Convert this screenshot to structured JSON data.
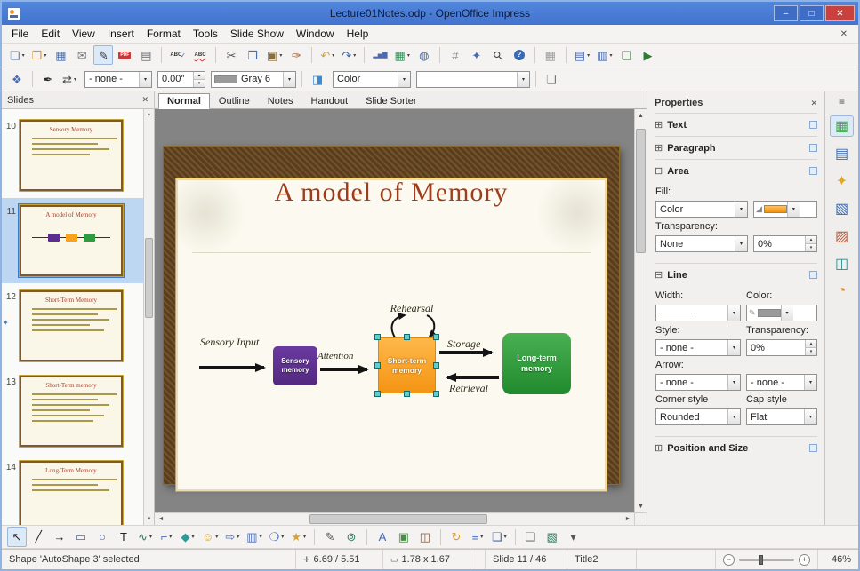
{
  "ui": {
    "dd": "▾",
    "up": "▴",
    "left": "◄",
    "right": "►",
    "scroll_up": "▲",
    "scroll_down": "▼",
    "indicator": "✦"
  },
  "titlebar": {
    "title": "Lecture01Notes.odp - OpenOffice Impress",
    "minimize": "–",
    "maximize": "□",
    "close": "✕"
  },
  "menubar": {
    "items": [
      "File",
      "Edit",
      "View",
      "Insert",
      "Format",
      "Tools",
      "Slide Show",
      "Window",
      "Help"
    ],
    "close": "✕"
  },
  "main_toolbar": [
    {
      "name": "new-document",
      "glyph": "❏",
      "color": "#5a86c8",
      "dd": true
    },
    {
      "name": "open",
      "glyph": "❒",
      "color": "#d89a3a",
      "dd": true
    },
    {
      "name": "save",
      "glyph": "▦",
      "color": "#4a6da7"
    },
    {
      "name": "document-as-email",
      "glyph": "✉",
      "color": "#7a7a7a"
    },
    {
      "name": "edit-file",
      "glyph": "✎",
      "color": "#333333",
      "active": true
    },
    {
      "name": "export-pdf",
      "glyph": "PDF",
      "badge": "#c83a3a"
    },
    {
      "name": "print",
      "glyph": "▤",
      "color": "#666666"
    },
    {
      "sep": true
    },
    {
      "name": "spellcheck",
      "abc": "check"
    },
    {
      "name": "autospellcheck",
      "abc": "wavy"
    },
    {
      "sep": true
    },
    {
      "name": "cut",
      "glyph": "✂",
      "color": "#555555"
    },
    {
      "name": "copy",
      "glyph": "❐",
      "color": "#4a6da7"
    },
    {
      "name": "paste",
      "glyph": "▣",
      "color": "#8a6d3b",
      "dd": true
    },
    {
      "name": "format-paintbrush",
      "glyph": "✑",
      "color": "#a05a2a"
    },
    {
      "sep": true
    },
    {
      "name": "undo",
      "glyph": "↶",
      "color": "#d8a23a",
      "dd": true
    },
    {
      "name": "redo",
      "glyph": "↷",
      "color": "#3a6ab0",
      "dd": true
    },
    {
      "sep": true
    },
    {
      "name": "chart",
      "glyph": "▂▅▇",
      "color": "#4a6ab0",
      "sm": true
    },
    {
      "name": "table",
      "glyph": "▦",
      "color": "#3a8a5a",
      "dd": true
    },
    {
      "name": "hyperlink",
      "glyph": "◍",
      "color": "#3a6ab0"
    },
    {
      "sep": true
    },
    {
      "name": "show-grid",
      "glyph": "#",
      "color": "#888888"
    },
    {
      "name": "navigator",
      "glyph": "✦",
      "color": "#4a6ab0"
    },
    {
      "name": "zoom",
      "glyph": "⚲",
      "color": "#444444"
    },
    {
      "name": "help",
      "glyph": "?",
      "badge": "#3a6ab0",
      "round": true
    },
    {
      "sep": true
    },
    {
      "name": "display-grid",
      "glyph": "▦",
      "color": "#999999"
    },
    {
      "sep": true
    },
    {
      "name": "slide-design",
      "glyph": "▤",
      "color": "#4a6ab0",
      "dd": true
    },
    {
      "name": "slide-layout",
      "glyph": "▥",
      "color": "#4a6ab0",
      "dd": true
    },
    {
      "name": "duplicate-slide",
      "glyph": "❏",
      "color": "#4a8a4a"
    },
    {
      "name": "slide-show",
      "glyph": "▶",
      "color": "#2e7d32"
    }
  ],
  "linefill_toolbar": {
    "line_style": "- none -",
    "line_width": "0.00\"",
    "line_color": "Gray 6",
    "fill_type": "Color",
    "fill_color": ""
  },
  "slides_panel": {
    "title": "Slides",
    "close": "✕",
    "slides": [
      {
        "number": "10",
        "title": "Sensory Memory",
        "kind": "bullets",
        "bullets": 4
      },
      {
        "number": "11",
        "title": "A model of Memory",
        "kind": "diagram",
        "selected": true
      },
      {
        "number": "12",
        "title": "Short-Term Memory",
        "kind": "bullets",
        "bullets": 5,
        "indicator": true
      },
      {
        "number": "13",
        "title": "Short-Term memory",
        "kind": "bullets",
        "bullets": 6
      },
      {
        "number": "14",
        "title": "Long-Term Memory",
        "kind": "bullets",
        "bullets": 3
      }
    ],
    "box_colors": [
      "#5c2d91",
      "#f9a21a",
      "#2e9b3e"
    ]
  },
  "view_tabs": [
    {
      "label": "Normal",
      "active": true
    },
    {
      "label": "Outline"
    },
    {
      "label": "Notes"
    },
    {
      "label": "Handout"
    },
    {
      "label": "Slide Sorter"
    }
  ],
  "slide": {
    "title": "A model of Memory",
    "labels": {
      "input": "Sensory Input",
      "attention": "Attention",
      "rehearsal": "Rehearsal",
      "storage": "Storage",
      "retrieval": "Retrieval"
    },
    "boxes": {
      "sensory_line1": "Sensory",
      "sensory_line2": "memory",
      "short_line1": "Short-term",
      "short_line2": "memory",
      "long_line1": "Long-term",
      "long_line2": "memory"
    }
  },
  "properties": {
    "title": "Properties",
    "close": "✕",
    "exp_plus": "⊞",
    "exp_minus": "⊟",
    "icons": {
      "fill": "◢",
      "pencil": "✎"
    },
    "sections": {
      "text": "Text",
      "paragraph": "Paragraph",
      "area": "Area",
      "line": "Line",
      "possize": "Position and Size"
    },
    "area": {
      "fill_label": "Fill:",
      "fill_type": "Color",
      "transparency_label": "Transparency:",
      "transparency_type": "None",
      "transparency_value": "0%"
    },
    "line": {
      "width_label": "Width:",
      "color_label": "Color:",
      "style_label": "Style:",
      "style_value": "- none -",
      "transparency_label": "Transparency:",
      "transparency_value": "0%",
      "arrow_label": "Arrow:",
      "arrow_start": "- none -",
      "arrow_end": "- none -",
      "corner_label": "Corner style",
      "corner_value": "Rounded",
      "cap_label": "Cap style",
      "cap_value": "Flat"
    }
  },
  "sidebar_tabs": [
    {
      "name": "sidebar-properties-tab",
      "glyph": "▦",
      "color": "#3fae49",
      "active": true
    },
    {
      "name": "sidebar-master-pages-tab",
      "glyph": "▤",
      "color": "#3a6ab0"
    },
    {
      "name": "sidebar-custom-animation-tab",
      "glyph": "✦",
      "color": "#e0a82a"
    },
    {
      "name": "sidebar-slide-transition-tab",
      "glyph": "▧",
      "color": "#3a6ab0"
    },
    {
      "name": "sidebar-styles-tab",
      "glyph": "▨",
      "color": "#b05a3a"
    },
    {
      "name": "sidebar-gallery-tab",
      "glyph": "◫",
      "color": "#2e8b8b"
    },
    {
      "name": "sidebar-navigator-tab",
      "glyph": "◔",
      "color": "#e08a2a"
    }
  ],
  "sidebar_menu": "≡",
  "draw_toolbar": [
    {
      "name": "select",
      "glyph": "↖",
      "color": "#222222",
      "active": true
    },
    {
      "name": "line",
      "glyph": "╱",
      "color": "#222222"
    },
    {
      "name": "line-arrow-end",
      "glyph": "→",
      "color": "#222222"
    },
    {
      "name": "rectangle",
      "glyph": "▭",
      "color": "#4a6ab0"
    },
    {
      "name": "ellipse",
      "glyph": "○",
      "color": "#4a6ab0"
    },
    {
      "name": "text",
      "glyph": "T",
      "color": "#222222"
    },
    {
      "name": "curve",
      "glyph": "∿",
      "color": "#2a7a5a",
      "dd": true
    },
    {
      "name": "connector",
      "glyph": "⌐",
      "color": "#4a6ab0",
      "dd": true
    },
    {
      "name": "basic-shapes",
      "glyph": "◆",
      "color": "#2a9a9a",
      "dd": true
    },
    {
      "name": "symbol-shapes",
      "glyph": "☺",
      "color": "#d8a23a",
      "dd": true
    },
    {
      "name": "block-arrows",
      "glyph": "⇨",
      "color": "#4a6ab0",
      "dd": true
    },
    {
      "name": "flowchart",
      "glyph": "▥",
      "color": "#4a6ab0",
      "dd": true
    },
    {
      "name": "callouts",
      "glyph": "❍",
      "color": "#4a6ab0",
      "dd": true
    },
    {
      "name": "stars",
      "glyph": "★",
      "color": "#d8a23a",
      "dd": true
    },
    {
      "sep": true
    },
    {
      "name": "edit-points",
      "glyph": "✎",
      "color": "#555555"
    },
    {
      "name": "glue-points",
      "glyph": "⊚",
      "color": "#2a7a5a"
    },
    {
      "sep": true
    },
    {
      "name": "fontwork-gallery",
      "glyph": "A",
      "color": "#3a6ab0"
    },
    {
      "name": "insert-picture",
      "glyph": "▣",
      "color": "#4a8a4a"
    },
    {
      "name": "gallery",
      "glyph": "◫",
      "color": "#8a5a3a"
    },
    {
      "sep": true
    },
    {
      "name": "rotate",
      "glyph": "↻",
      "color": "#d89a2a"
    },
    {
      "name": "alignment",
      "glyph": "≡",
      "color": "#4a6ab0",
      "dd": true
    },
    {
      "name": "arrange",
      "glyph": "❏",
      "color": "#4a6ab0",
      "dd": true
    },
    {
      "sep": true
    },
    {
      "name": "shadow",
      "glyph": "❏",
      "color": "#777777"
    },
    {
      "name": "extrusion",
      "glyph": "▧",
      "color": "#2a7a5a"
    },
    {
      "name": "toolbar-options",
      "glyph": "▾",
      "color": "#555555"
    }
  ],
  "statusbar": {
    "shape_info": "Shape 'AutoShape 3' selected",
    "pos_icon": "✛",
    "position": "6.69 / 5.51",
    "size_icon": "▭",
    "size": "1.78 x 1.67",
    "slide": "Slide 11 / 46",
    "layout": "Title2",
    "zoom_out": "−",
    "zoom_in": "+",
    "zoom": "46%"
  }
}
